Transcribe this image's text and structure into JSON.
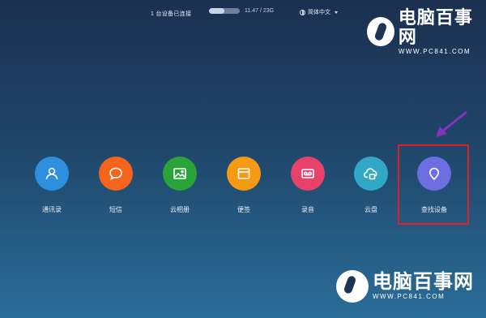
{
  "topbar": {
    "device_status": "1 台设备已连接",
    "storage_text": "11.47 / 23G",
    "storage_used_fraction": 0.5,
    "language": "简体中文"
  },
  "watermark": {
    "title": "电脑百事网",
    "url": "WWW.PC841.COM"
  },
  "apps": [
    {
      "label": "通讯录",
      "color": "#2f8fdf",
      "icon": "contacts-icon"
    },
    {
      "label": "短信",
      "color": "#f4641d",
      "icon": "message-icon"
    },
    {
      "label": "云相册",
      "color": "#2aa33b",
      "icon": "gallery-icon"
    },
    {
      "label": "便签",
      "color": "#f59a12",
      "icon": "notes-icon"
    },
    {
      "label": "录音",
      "color": "#e6426a",
      "icon": "recorder-icon"
    },
    {
      "label": "云盘",
      "color": "#32a7c6",
      "icon": "cloud-drive-icon"
    },
    {
      "label": "查找设备",
      "color": "#6c6ee2",
      "icon": "find-device-icon"
    }
  ],
  "annotation_colors": {
    "box": "#e02020",
    "arrow": "#8a2fc4"
  }
}
